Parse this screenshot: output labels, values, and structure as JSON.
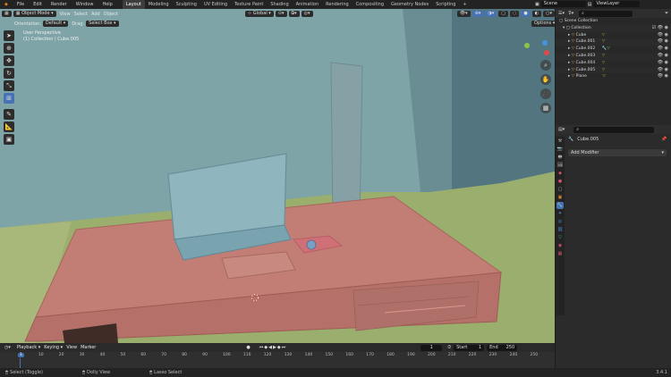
{
  "topbar": {
    "menus": [
      "File",
      "Edit",
      "Render",
      "Window",
      "Help"
    ],
    "workspaces": [
      "Layout",
      "Modeling",
      "Sculpting",
      "UV Editing",
      "Texture Paint",
      "Shading",
      "Animation",
      "Rendering",
      "Compositing",
      "Geometry Nodes",
      "Scripting"
    ],
    "active_workspace": "Layout",
    "scene_label": "Scene",
    "viewlayer_label": "ViewLayer"
  },
  "viewport": {
    "mode": "Object Mode",
    "menus": [
      "View",
      "Select",
      "Add",
      "Object"
    ],
    "orientation_label": "Orientation:",
    "orientation_value": "Default",
    "drag_label": "Drag:",
    "drag_value": "Select Box",
    "transform_orientation": "Global",
    "options_label": "Options",
    "overlay_line1": "User Perspective",
    "overlay_line2": "(1) Collection | Cube.005",
    "background_color": "#7ea4a7"
  },
  "outliner": {
    "search_placeholder": "",
    "root": "Scene Collection",
    "collection": "Collection",
    "items": [
      "Cube",
      "Cube.001",
      "Cube.002",
      "Cube.003",
      "Cube.004",
      "Cube.005",
      "Plane"
    ]
  },
  "properties": {
    "object_name": "Cube.005",
    "add_modifier_label": "Add Modifier"
  },
  "timeline": {
    "menus": [
      "Playback",
      "Keying",
      "View",
      "Marker"
    ],
    "current_frame": "1",
    "start_label": "Start",
    "start_value": "1",
    "end_label": "End",
    "end_value": "250",
    "ticks": [
      "1",
      "10",
      "20",
      "30",
      "40",
      "50",
      "60",
      "70",
      "80",
      "90",
      "100",
      "110",
      "120",
      "130",
      "140",
      "150",
      "160",
      "170",
      "180",
      "190",
      "200",
      "210",
      "220",
      "230",
      "240",
      "250"
    ],
    "playhead": "1"
  },
  "statusbar": {
    "select": "Select (Toggle)",
    "dolly": "Dolly View",
    "lasso": "Lasso Select",
    "version": "3.4.1"
  },
  "icons": {
    "mode": "object-mode-icon",
    "cursor": "cursor-tool-icon",
    "move": "move-tool-icon",
    "rotate": "rotate-tool-icon",
    "scale": "scale-tool-icon",
    "transform": "transform-tool-icon",
    "annotate": "annotate-tool-icon",
    "measure": "measure-tool-icon",
    "add-cube": "add-cube-tool-icon"
  }
}
